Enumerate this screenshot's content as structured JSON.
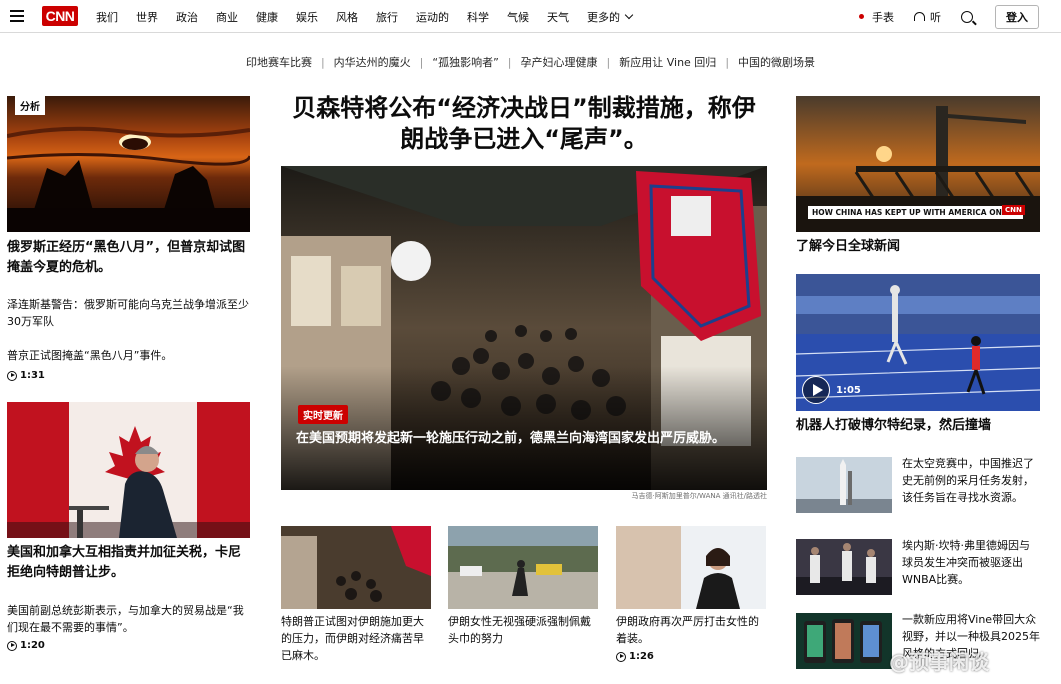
{
  "nav": {
    "brand": "CNN",
    "links": [
      "我们",
      "世界",
      "政治",
      "商业",
      "健康",
      "娱乐",
      "风格",
      "旅行",
      "运动的",
      "科学",
      "气候",
      "天气"
    ],
    "more": "更多的",
    "live": "手表",
    "listen": "听",
    "login": "登入"
  },
  "subnav": [
    "印地赛车比赛",
    "内华达州的魔火",
    "“孤独影响者”",
    "孕产妇心理健康",
    "新应用让 Vine 回归",
    "中国的微剧场景"
  ],
  "left": {
    "tag": "分析",
    "headline1": "俄罗斯正经历“黑色八月”，但普京却试图掩盖今夏的危机。",
    "item1": "泽连斯基警告：俄罗斯可能向乌克兰战争增派至少30万军队",
    "item2": "普京正试图掩盖“黑色八月”事件。",
    "video1": "1:31",
    "headline2": "美国和加拿大互相指责并加征关税，卡尼拒绝向特朗普让步。",
    "item3": "美国前副总统彭斯表示，与加拿大的贸易战是“我们现在最不需要的事情”。",
    "video2": "1:20"
  },
  "center": {
    "headline": "贝森特将公布“经济决战日”制裁措施，称伊朗战争已进入“尾声”。",
    "badge": "实时更新",
    "overlay": "在美国预期将发起新一轮施压行动之前，德黑兰向海湾国家发出严厉威胁。",
    "credit": "马吉德·阿斯加里普尔/WANA 通讯社/路透社",
    "thumb1": "特朗普正试图对伊朗施加更大的压力，而伊朗对经济痛苦早已麻木。",
    "thumb2": "伊朗女性无视强硬派强制佩戴头巾的努力",
    "thumb3": "伊朗政府再次严厉打击女性的着装。",
    "thumb3_video": "1:26"
  },
  "right": {
    "img1_caption": "HOW CHINA HAS KEPT UP WITH AMERICA ON A.I.",
    "img1_logo": "CNN",
    "headline1": "了解今日全球新闻",
    "video1": "1:05",
    "headline2": "机器人打破博尔特纪录，然后撞墙",
    "item1": "在太空竞赛中，中国推迟了史无前例的采月任务发射，该任务旨在寻找水资源。",
    "item2": "埃内斯·坎特·弗里德姆因与球员发生冲突而被驱逐出WNBA比赛。",
    "item3": "一款新应用将Vine带回大众视野，并以一种极具2025年风格的方式回归。"
  },
  "watermark": "@预事闲谈",
  "colors": {
    "brand": "#cc0000",
    "text": "#0c0c0c",
    "badge": "#cc0000"
  }
}
